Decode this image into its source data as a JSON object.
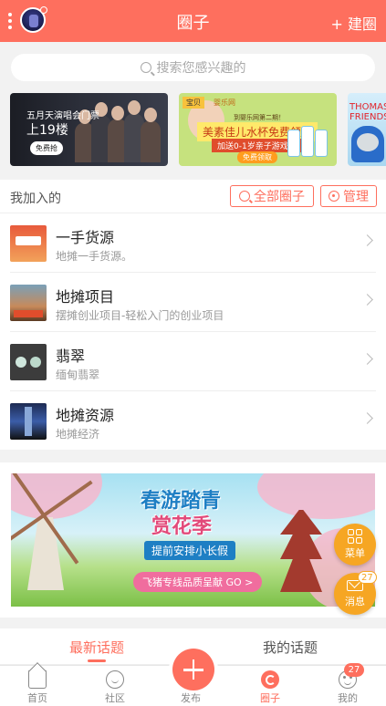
{
  "header": {
    "title": "圈子",
    "create_label": "+ 建圈"
  },
  "search": {
    "placeholder": "搜索您感兴趣的"
  },
  "banners": [
    {
      "line1": "五月天演唱会门票",
      "line2": "上19楼",
      "button": "免费抢"
    },
    {
      "brand": "宝贝",
      "brand2": "婴乐网",
      "sub": "到婴乐网第二期！",
      "headline": "美素佳儿水杯免费领取",
      "tag": "加送0-1岁亲子游戏书",
      "cta": "免费领取"
    },
    {
      "brand": "THOMAS & FRIENDS"
    }
  ],
  "joined": {
    "title": "我加入的",
    "all_groups_label": "全部圈子",
    "manage_label": "管理",
    "groups": [
      {
        "name": "一手货源",
        "description": "地摊一手货源。"
      },
      {
        "name": "地摊项目",
        "description": "摆摊创业项目-轻松入门的创业项目"
      },
      {
        "name": "翡翠",
        "description": "缅甸翡翠"
      },
      {
        "name": "地摊资源",
        "description": "地摊经济"
      }
    ]
  },
  "ad": {
    "title_line1": "春游踏青",
    "title_line2": "赏花季",
    "tagline": "提前安排小长假",
    "cta": "飞猪专线品质呈献 GO >"
  },
  "floating": {
    "menu_label": "菜单",
    "message_label": "消息",
    "message_count": "27"
  },
  "topic_tabs": {
    "latest": "最新话题",
    "mine": "我的话题"
  },
  "tabbar": {
    "home": "首页",
    "community": "社区",
    "publish": "发布",
    "circle": "圈子",
    "me": "我的",
    "me_badge": "27"
  },
  "colors": {
    "primary": "#fe6f5e",
    "floating": "#f6a623"
  }
}
